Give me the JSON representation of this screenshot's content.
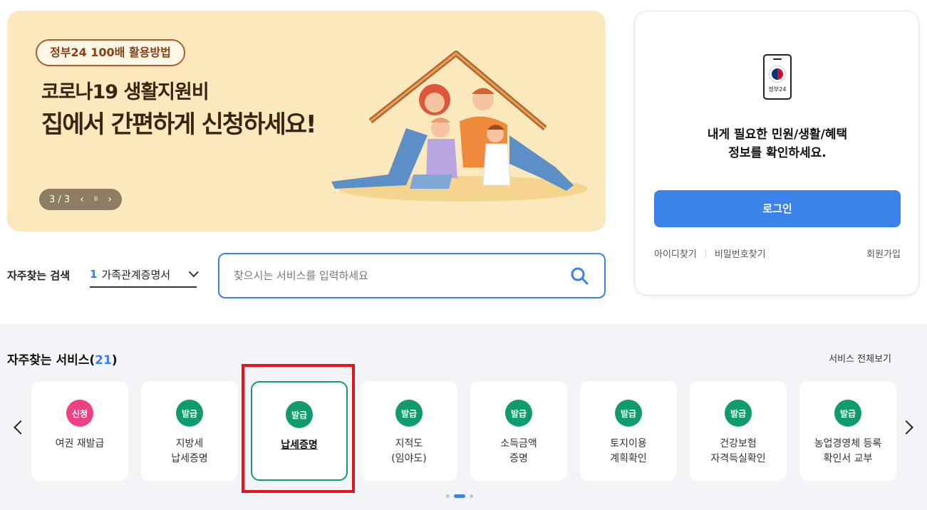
{
  "banner": {
    "tag": "정부24 100배 활용방법",
    "line1": "코로나19 생활지원비",
    "line2": "집에서 간편하게 신청하세요!",
    "counter": "3 / 3",
    "prev_icon": "‹",
    "pause_icon": "II",
    "next_icon": "›"
  },
  "login": {
    "app_label": "정부24",
    "message_line1": "내게 필요한 민원/생활/혜택",
    "message_line2": "정보를 확인하세요.",
    "button": "로그인",
    "find_id": "아이디찾기",
    "find_pw": "비밀번호찾기",
    "signup": "회원가입"
  },
  "frequent_search": {
    "label": "자주찾는 검색",
    "rank": "1",
    "selected": "가족관계증명서"
  },
  "search": {
    "placeholder": "찾으시는 서비스를 입력하세요"
  },
  "services": {
    "title": "자주찾는 서비스(",
    "count": "21",
    "title_end": ")",
    "view_all": "서비스 전체보기",
    "items": [
      {
        "badge": "신청",
        "name": "여권 재발급"
      },
      {
        "badge": "발급",
        "name": "지방세\n납세증명"
      },
      {
        "badge": "발급",
        "name": "납세증명"
      },
      {
        "badge": "발급",
        "name": "지적도\n(임야도)"
      },
      {
        "badge": "발급",
        "name": "소득금액\n증명"
      },
      {
        "badge": "발급",
        "name": "토지이용\n계획확인"
      },
      {
        "badge": "발급",
        "name": "건강보험\n자격득실확인"
      },
      {
        "badge": "발급",
        "name": "농업경영체 등록\n확인서 교부"
      }
    ]
  },
  "colors": {
    "accent_blue": "#3a82ea",
    "badge_green": "#109c6a",
    "badge_pink": "#ef3f85",
    "highlight_red": "#e8131a",
    "banner_bg": "#fbe8bd"
  }
}
